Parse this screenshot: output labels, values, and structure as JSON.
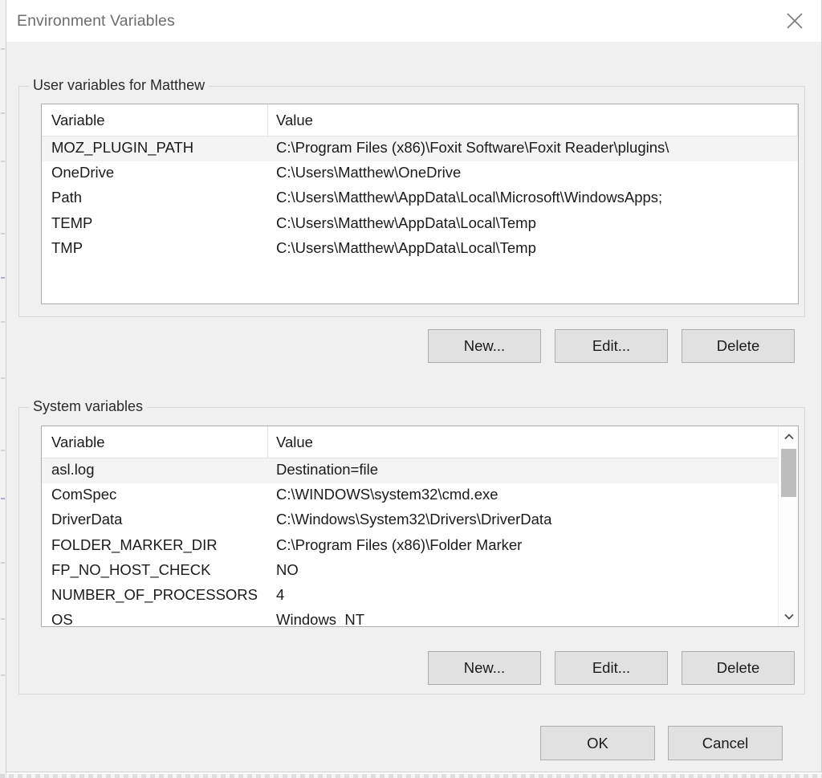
{
  "window": {
    "title": "Environment Variables",
    "close_icon": "close-icon"
  },
  "user_section": {
    "legend": "User variables for Matthew",
    "columns": [
      "Variable",
      "Value"
    ],
    "rows": [
      {
        "variable": "MOZ_PLUGIN_PATH",
        "value": "C:\\Program Files (x86)\\Foxit Software\\Foxit Reader\\plugins\\",
        "selected": true
      },
      {
        "variable": "OneDrive",
        "value": "C:\\Users\\Matthew\\OneDrive",
        "selected": false
      },
      {
        "variable": "Path",
        "value": "C:\\Users\\Matthew\\AppData\\Local\\Microsoft\\WindowsApps;",
        "selected": false
      },
      {
        "variable": "TEMP",
        "value": "C:\\Users\\Matthew\\AppData\\Local\\Temp",
        "selected": false
      },
      {
        "variable": "TMP",
        "value": "C:\\Users\\Matthew\\AppData\\Local\\Temp",
        "selected": false
      }
    ],
    "buttons": {
      "new": "New...",
      "edit": "Edit...",
      "delete": "Delete"
    }
  },
  "system_section": {
    "legend": "System variables",
    "columns": [
      "Variable",
      "Value"
    ],
    "rows": [
      {
        "variable": "asl.log",
        "value": "Destination=file",
        "selected": true
      },
      {
        "variable": "ComSpec",
        "value": "C:\\WINDOWS\\system32\\cmd.exe",
        "selected": false
      },
      {
        "variable": "DriverData",
        "value": "C:\\Windows\\System32\\Drivers\\DriverData",
        "selected": false
      },
      {
        "variable": "FOLDER_MARKER_DIR",
        "value": "C:\\Program Files (x86)\\Folder Marker",
        "selected": false
      },
      {
        "variable": "FP_NO_HOST_CHECK",
        "value": "NO",
        "selected": false
      },
      {
        "variable": "NUMBER_OF_PROCESSORS",
        "value": "4",
        "selected": false
      },
      {
        "variable": "OS",
        "value": "Windows_NT",
        "selected": false
      }
    ],
    "buttons": {
      "new": "New...",
      "edit": "Edit...",
      "delete": "Delete"
    },
    "scrollbar": {
      "up_icon": "chevron-up-icon",
      "down_icon": "chevron-down-icon",
      "thumb": "scroll-thumb"
    }
  },
  "footer": {
    "ok": "OK",
    "cancel": "Cancel"
  },
  "colors": {
    "dialog_background": "#f0f0f0",
    "titlebar_background": "#ffffff",
    "title_text": "#6d6d6d",
    "list_background": "#ffffff",
    "list_border": "#adadad",
    "selected_row": "#f4f4f4",
    "button_face": "#e1e1e1",
    "button_border": "#adadad",
    "text": "#1b1b1b",
    "scroll_thumb": "#bdbdbd"
  }
}
